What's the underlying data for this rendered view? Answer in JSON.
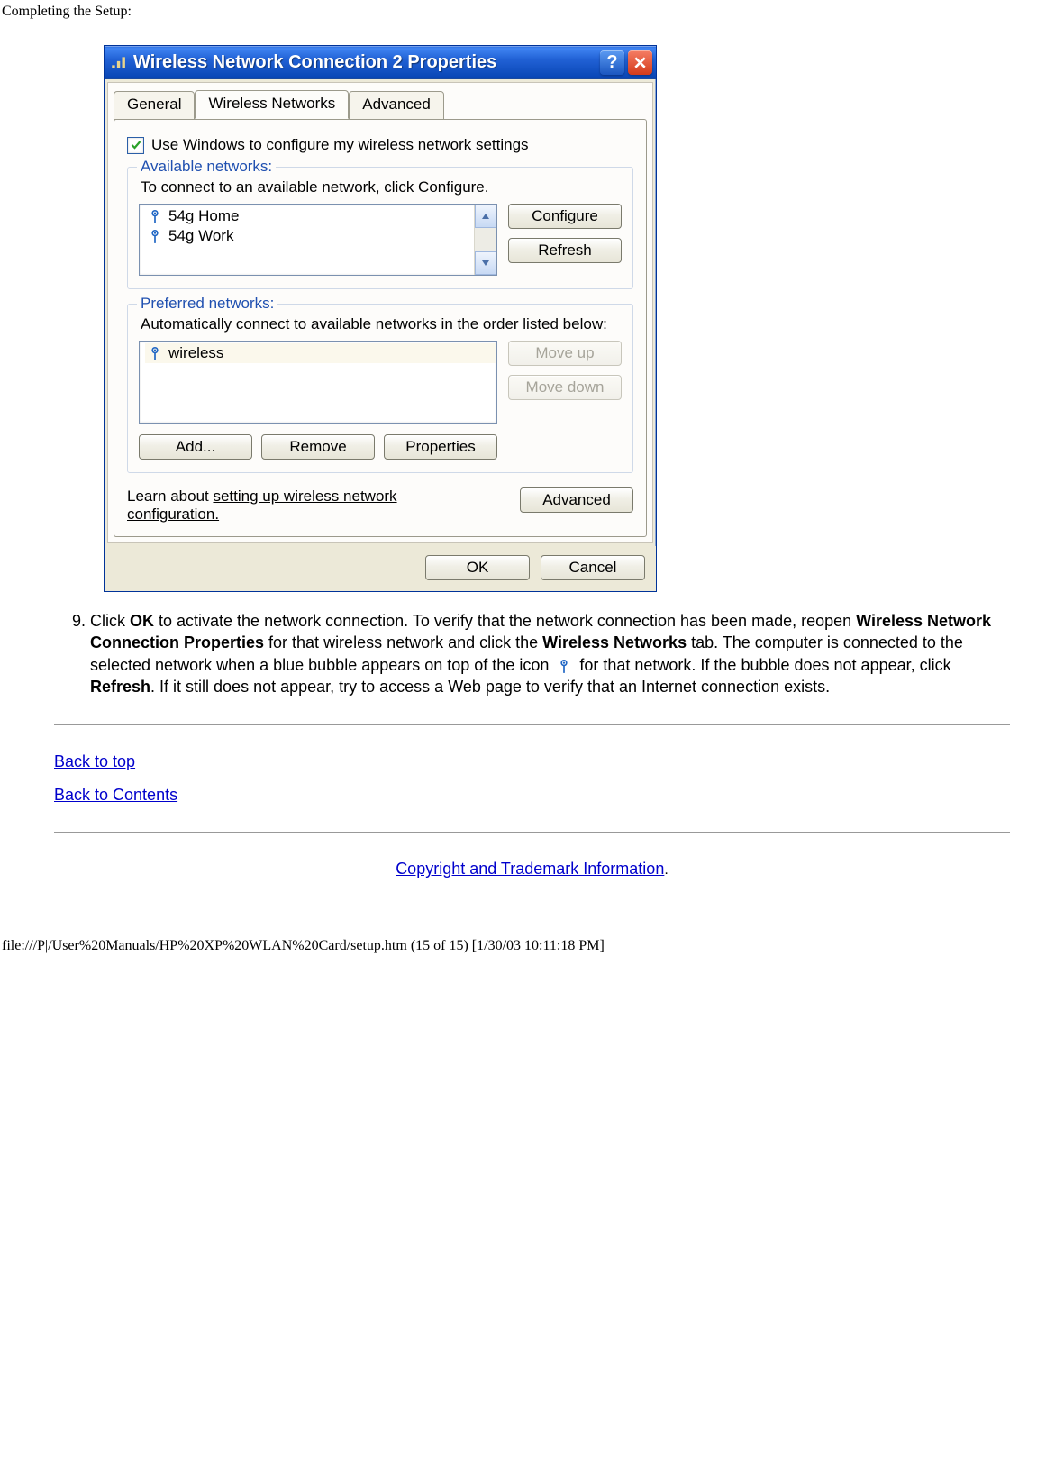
{
  "page_header": "Completing the Setup:",
  "dialog": {
    "title": "Wireless Network Connection 2 Properties",
    "tabs": [
      "General",
      "Wireless Networks",
      "Advanced"
    ],
    "active_tab": 1,
    "checkbox_label": "Use Windows to configure my wireless network settings",
    "checkbox_checked": true,
    "available": {
      "legend": "Available networks:",
      "text": "To connect to an available network, click Configure.",
      "items": [
        "54g Home",
        "54g Work"
      ],
      "buttons": {
        "configure": "Configure",
        "refresh": "Refresh"
      }
    },
    "preferred": {
      "legend": "Preferred networks:",
      "text": "Automatically connect to available networks in the order listed below:",
      "items": [
        "wireless"
      ],
      "buttons": {
        "move_up": "Move up",
        "move_down": "Move down"
      },
      "row_buttons": {
        "add": "Add...",
        "remove": "Remove",
        "properties": "Properties"
      }
    },
    "learn_prefix": "Learn about ",
    "learn_link": "setting up wireless network configuration.",
    "advanced_btn": "Advanced",
    "ok_btn": "OK",
    "cancel_btn": "Cancel"
  },
  "instruction": {
    "number": "9.",
    "parts": [
      "Click ",
      "OK",
      " to activate the network connection. To verify that the network connection has been made, reopen ",
      "Wireless Network Connection Properties",
      " for that wireless network and click the ",
      "Wireless Networks",
      " tab. The computer is connected to the selected network when a blue bubble appears on top of the icon ",
      " for that network. If the bubble does not appear, click ",
      "Refresh",
      ". If it still does not appear, try to access a Web page to verify that an Internet connection exists."
    ]
  },
  "links": {
    "back_to_top": "Back to top",
    "back_to_contents": "Back to Contents",
    "copyright": "Copyright and Trademark Information"
  },
  "footer": "file:///P|/User%20Manuals/HP%20XP%20WLAN%20Card/setup.htm (15 of 15) [1/30/03 10:11:18 PM]"
}
